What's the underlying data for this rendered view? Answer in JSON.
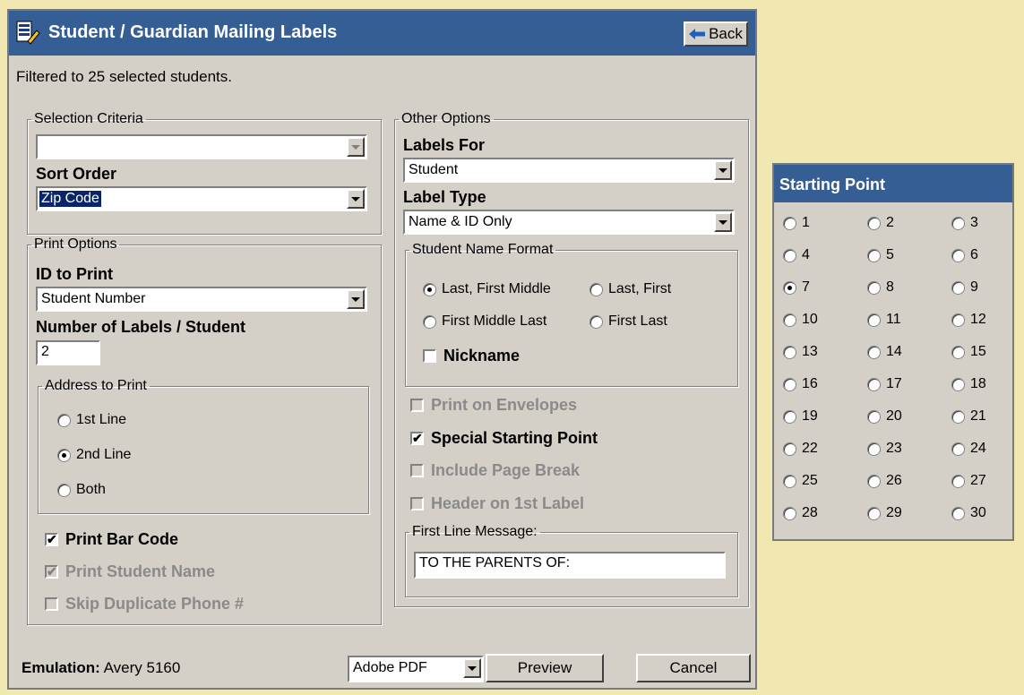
{
  "window": {
    "title": "Student / Guardian Mailing Labels",
    "back_label": "Back",
    "filter_text": "Filtered to 25 selected students."
  },
  "selection": {
    "legend": "Selection Criteria",
    "criteria_value": "",
    "sort_order_label": "Sort Order",
    "sort_order_value": "Zip Code"
  },
  "print_options": {
    "legend": "Print Options",
    "id_label": "ID to Print",
    "id_value": "Student Number",
    "num_labels_label": "Number of Labels / Student",
    "num_labels_value": "2",
    "address_legend": "Address to Print",
    "address_options": [
      "1st Line",
      "2nd Line",
      "Both"
    ],
    "address_selected": "2nd Line",
    "print_bar_code": "Print Bar Code",
    "print_student_name": "Print Student Name",
    "skip_duplicate": "Skip Duplicate Phone #"
  },
  "other_options": {
    "legend": "Other Options",
    "labels_for_label": "Labels For",
    "labels_for_value": "Student",
    "label_type_label": "Label Type",
    "label_type_value": "Name & ID Only",
    "name_format_legend": "Student Name Format",
    "name_formats": [
      "Last, First Middle",
      "Last, First",
      "First Middle Last",
      "First Last"
    ],
    "name_format_selected": "Last, First Middle",
    "nickname": "Nickname",
    "print_on_envelopes": "Print on Envelopes",
    "special_starting_point": "Special Starting Point",
    "include_page_break": "Include Page Break",
    "header_on_first": "Header on 1st Label",
    "first_line_legend": "First Line Message:",
    "first_line_value": "TO THE PARENTS OF:"
  },
  "footer": {
    "emulation_label": "Emulation:",
    "emulation_value": "Avery 5160",
    "output_value": "Adobe PDF",
    "preview_label": "Preview",
    "cancel_label": "Cancel"
  },
  "starting_point": {
    "title": "Starting Point",
    "options": [
      "1",
      "2",
      "3",
      "4",
      "5",
      "6",
      "7",
      "8",
      "9",
      "10",
      "11",
      "12",
      "13",
      "14",
      "15",
      "16",
      "17",
      "18",
      "19",
      "20",
      "21",
      "22",
      "23",
      "24",
      "25",
      "26",
      "27",
      "28",
      "29",
      "30"
    ],
    "selected": "7"
  },
  "colors": {
    "titlebar": "#355e94",
    "dialog": "#d4d0c8",
    "background": "#f0e8b0"
  },
  "icons": {
    "title": "labels-app-icon",
    "back": "back-arrow-icon"
  }
}
